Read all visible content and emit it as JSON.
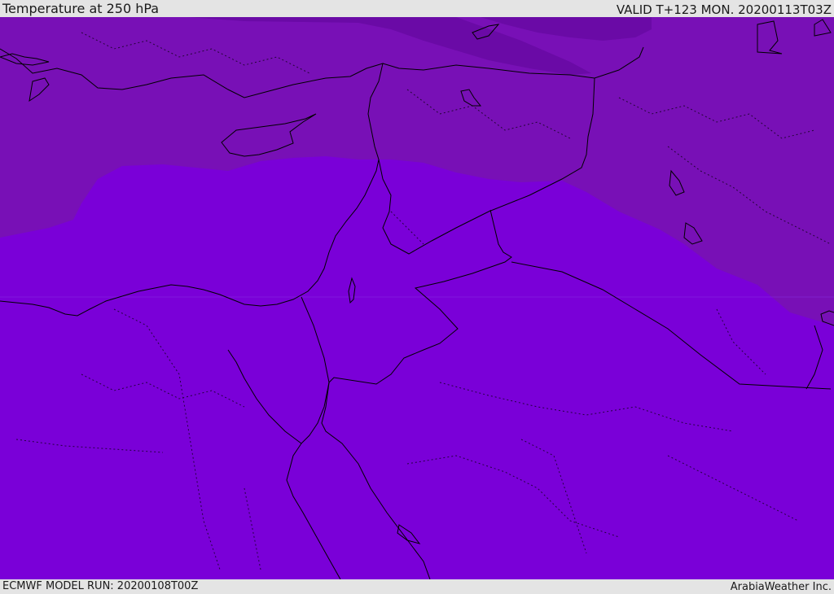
{
  "header": {
    "title": "Temperature at 250 hPa",
    "valid": "VALID T+123 MON. 20200113T03Z"
  },
  "footer": {
    "model_run": "ECMWF MODEL RUN: 20200108T00Z",
    "credit": "ArabiaWeather Inc."
  },
  "map": {
    "colors": {
      "warm_band": "#7a00d8",
      "mid_band": "#7810b6",
      "cold_band": "#6a0aa6",
      "coast": "#000000"
    }
  }
}
